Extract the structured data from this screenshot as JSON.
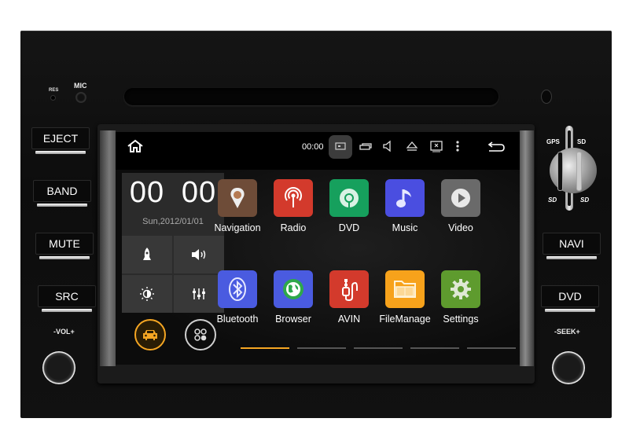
{
  "device": {
    "top_labels": {
      "res": "RES",
      "mic": "MIC"
    },
    "left_buttons": [
      "EJECT",
      "BAND",
      "MUTE",
      "SRC"
    ],
    "right_buttons": [
      "NAVI",
      "DVD"
    ],
    "knob_labels": {
      "volume": "-VOL+",
      "seek": "-SEEK+"
    },
    "card_slots": {
      "gps": "GPS",
      "sd": "SD",
      "sd_logo": "SD"
    }
  },
  "statusbar": {
    "time": "00:00",
    "icons": [
      "home-icon",
      "screenshot-icon",
      "recent-apps-icon",
      "volume-icon",
      "eject-icon",
      "close-screen-icon",
      "menu-dots-icon",
      "back-icon"
    ]
  },
  "widget": {
    "hours": "00",
    "minutes": "00",
    "date": "Sun,2012/01/01",
    "quick_actions": [
      "rocket-icon",
      "volume-icon",
      "brightness-icon",
      "equalizer-icon"
    ],
    "bottom_buttons": [
      "car-icon",
      "apps-grid-icon"
    ]
  },
  "apps": [
    {
      "label": "Navigation",
      "icon": "navigation-pin-icon",
      "color": "#6e4c38"
    },
    {
      "label": "Radio",
      "icon": "radio-antenna-icon",
      "color": "#d33a2c"
    },
    {
      "label": "DVD",
      "icon": "disc-icon",
      "color": "#16a05d"
    },
    {
      "label": "Music",
      "icon": "music-note-icon",
      "color": "#4a4ee0"
    },
    {
      "label": "Video",
      "icon": "play-icon",
      "color": "#6a6a6a"
    },
    {
      "label": "Bluetooth",
      "icon": "bluetooth-icon",
      "color": "#4a5be0"
    },
    {
      "label": "Browser",
      "icon": "globe-icon",
      "color": "#4a5be0"
    },
    {
      "label": "AVIN",
      "icon": "av-cable-icon",
      "color": "#d33a2c"
    },
    {
      "label": "FileManage",
      "icon": "folder-icon",
      "color": "#f7a21b"
    },
    {
      "label": "Settings",
      "icon": "gear-icon",
      "color": "#5e9b2e"
    }
  ],
  "pager": {
    "pages": 5,
    "active": 1,
    "active_color": "#f5a623",
    "inactive_color": "#555555"
  }
}
